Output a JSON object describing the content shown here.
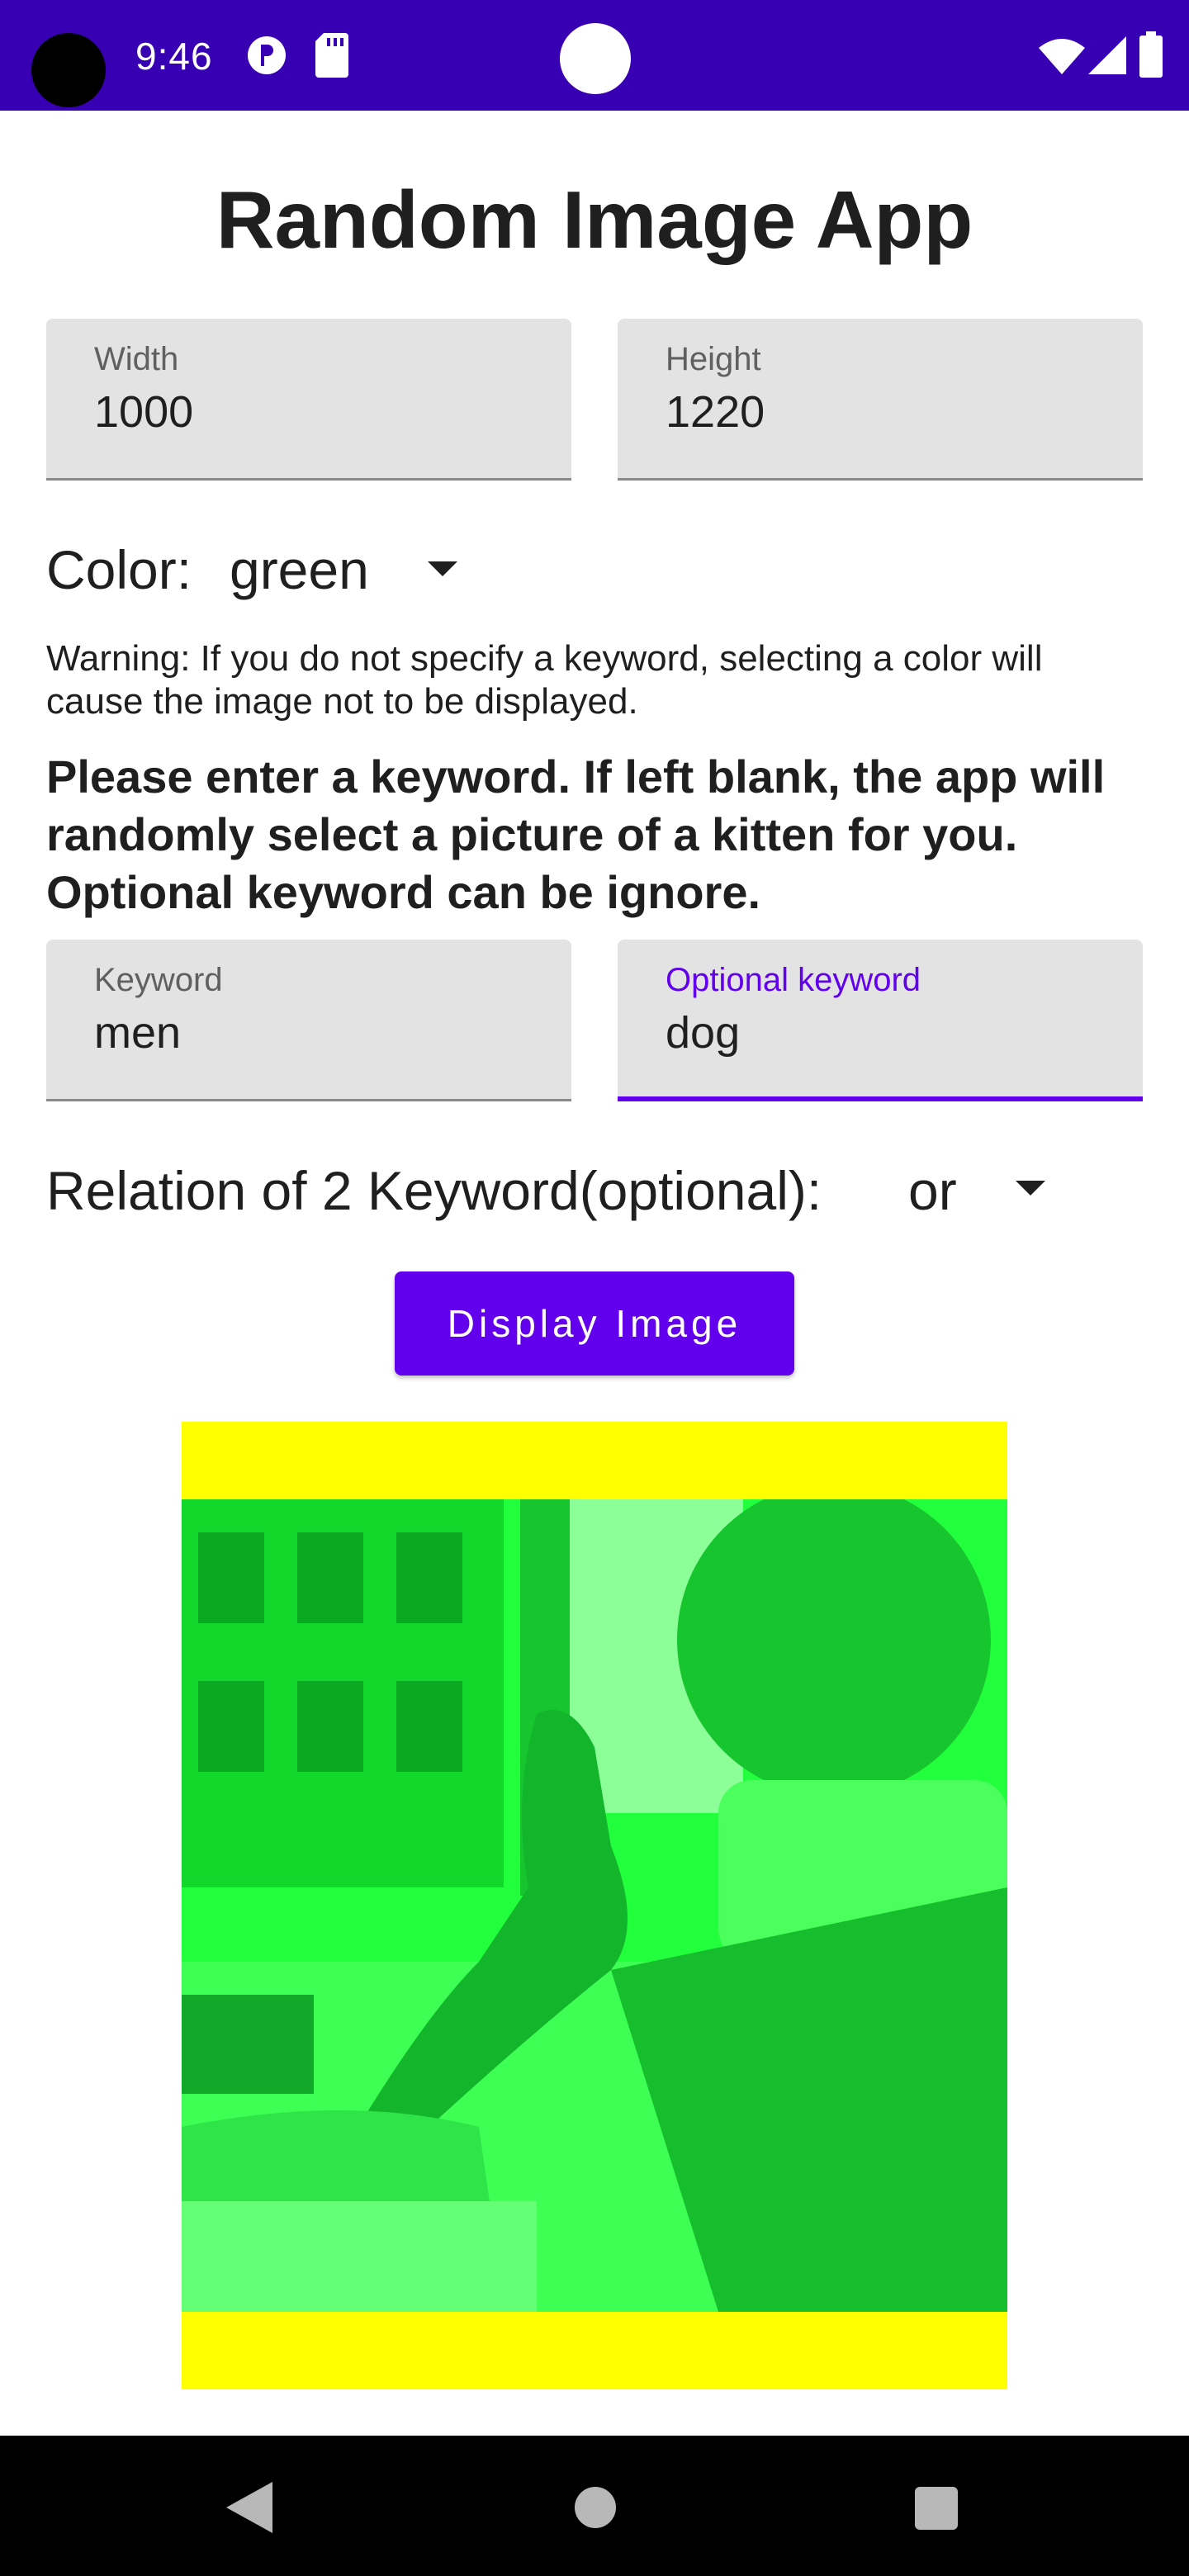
{
  "status_bar": {
    "time": "9:46"
  },
  "app": {
    "title": "Random Image App"
  },
  "size_fields": {
    "width": {
      "label": "Width",
      "value": "1000"
    },
    "height": {
      "label": "Height",
      "value": "1220"
    }
  },
  "color": {
    "label": "Color:",
    "value": "green"
  },
  "warning": "Warning: If you do not specify a keyword, selecting a color will cause the image not to be displayed.",
  "prompt": "Please enter a keyword. If left blank, the app will randomly select a picture of a kitten for you. Optional keyword can be ignore.",
  "keyword_fields": {
    "keyword": {
      "label": "Keyword",
      "value": "men"
    },
    "optional_keyword": {
      "label": "Optional keyword",
      "value": "dog"
    }
  },
  "relation": {
    "label": "Relation of 2 Keyword(optional):",
    "value": "or"
  },
  "display_button": {
    "label": "Display Image"
  },
  "colors": {
    "status_bar": "#3700b3",
    "accent": "#6200ee",
    "image_letterbox": "#ffff00",
    "image_tint": "#22ff3d"
  },
  "icons": {
    "status": [
      "notification-icon",
      "sd-card-icon",
      "wifi-icon",
      "signal-icon",
      "battery-icon"
    ],
    "navigation": [
      "back-icon",
      "home-icon",
      "recents-icon"
    ]
  }
}
